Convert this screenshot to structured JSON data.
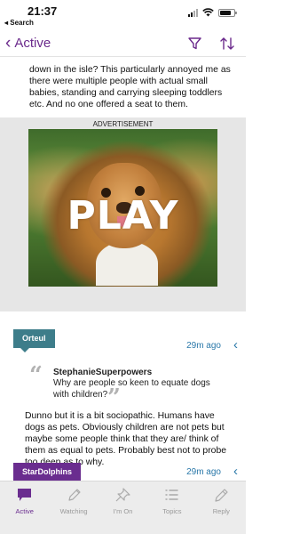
{
  "status_bar": {
    "time": "21:37",
    "back_label": "◂ Search"
  },
  "nav": {
    "title": "Active",
    "accent_color": "#6b2a8c"
  },
  "post": {
    "top_text": "down in the isle? This particularly annoyed me as there were multiple people with actual small babies, standing and carrying sleeping toddlers etc. And no one offered a seat to them."
  },
  "ad": {
    "label": "ADVERTISEMENT",
    "overlay_text": "PLAY"
  },
  "replies": [
    {
      "author": "Orteul",
      "time": "29m ago",
      "badge_color": "#3d7d8a",
      "quote": {
        "author": "StephanieSuperpowers",
        "text": "Why are people so keen to equate dogs with children?"
      },
      "body": "Dunno but it is a bit sociopathic. Humans have dogs as pets. Obviously children are not pets but maybe some people think that they are/ think of them as equal to pets. Probably best not to probe too deep as to why."
    },
    {
      "author": "StarDolphins",
      "time": "29m ago",
      "badge_color": "#6a2d8f"
    }
  ],
  "tabs": [
    {
      "label": "Active",
      "icon": "speech-bubble-icon",
      "active": true
    },
    {
      "label": "Watching",
      "icon": "pen-icon",
      "active": false
    },
    {
      "label": "I'm On",
      "icon": "pin-icon",
      "active": false
    },
    {
      "label": "Topics",
      "icon": "list-icon",
      "active": false
    },
    {
      "label": "Reply",
      "icon": "pencil-icon",
      "active": false
    }
  ]
}
